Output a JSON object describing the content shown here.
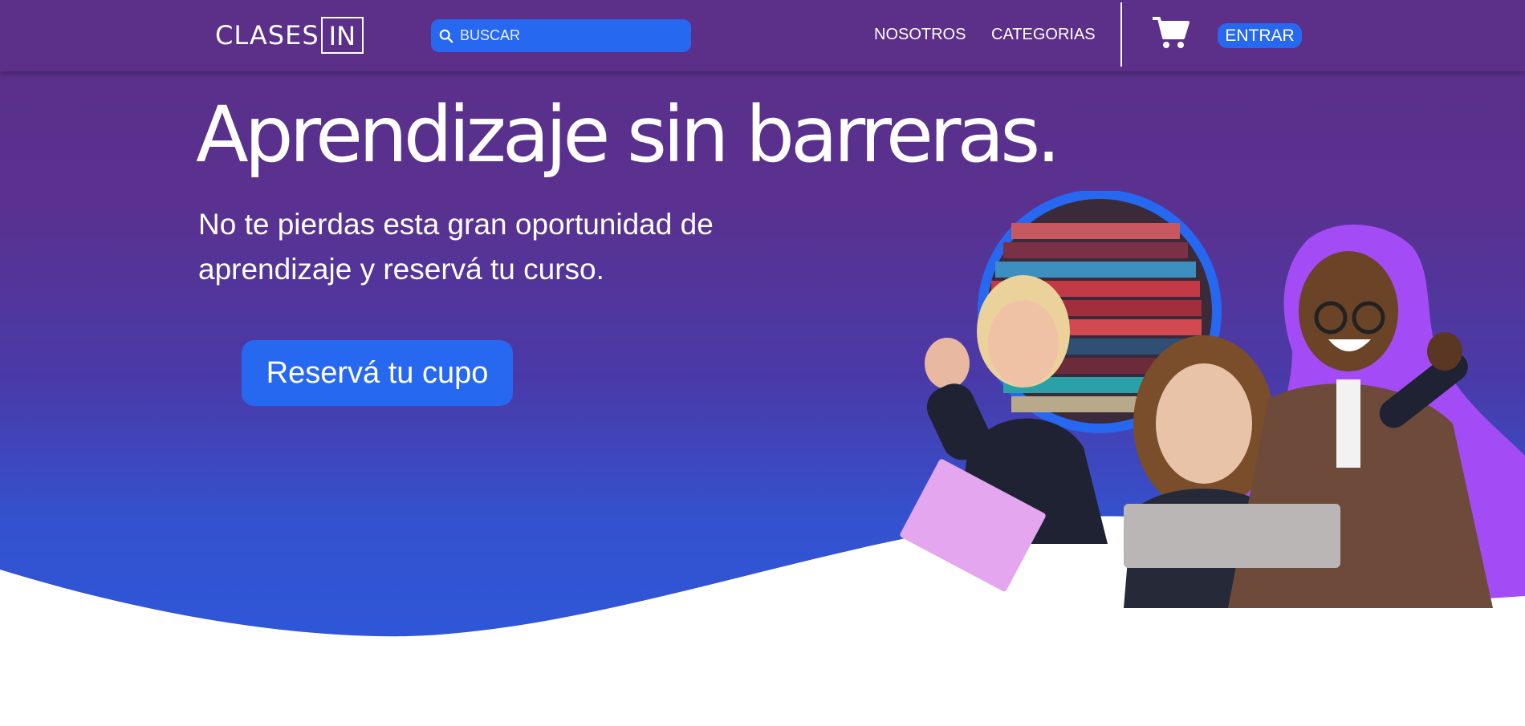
{
  "header": {
    "logo_main": "CLASES",
    "logo_box": "IN",
    "search_placeholder": "BUSCAR",
    "nav": [
      "NOSOTROS",
      "CATEGORIAS"
    ],
    "login_label": "ENTRAR"
  },
  "hero": {
    "headline": "Aprendizaje sin barreras.",
    "subtitle": "No te pierdas esta gran oportunidad de aprendizaje y reservá tu curso.",
    "cta_label": "Reservá tu cupo"
  },
  "colors": {
    "nav_bg": "#5c2f89",
    "accent_blue": "#2768f0",
    "hero_gradient_top": "#5b2f8a",
    "hero_gradient_bottom": "#2a5ade",
    "purple_outline": "#a34cf6"
  },
  "icons": [
    "search-icon",
    "shopping-cart-icon"
  ]
}
